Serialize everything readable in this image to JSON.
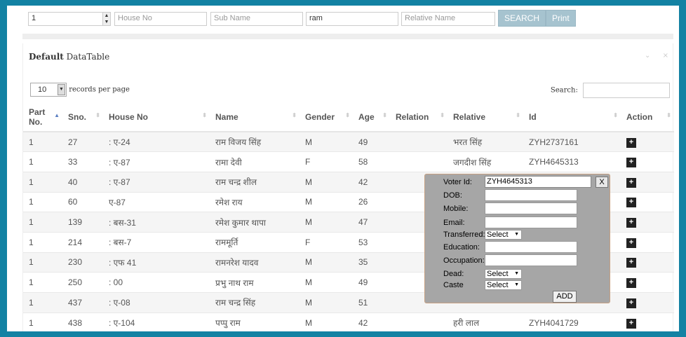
{
  "filters": {
    "part_value": "1",
    "house_placeholder": "House No",
    "subname_placeholder": "Sub Name",
    "name_value": "ram",
    "relative_placeholder": "Relative Name",
    "search_label": "SEARCH",
    "print_label": "Print"
  },
  "panel": {
    "title_bold": "Default",
    "title_rest": " DataTable",
    "collapse_icon": "⌄",
    "close_icon": "×"
  },
  "length": {
    "value": "10",
    "suffix": "records per page"
  },
  "search": {
    "label": "Search:"
  },
  "table": {
    "headers": [
      "Part No.",
      "Sno.",
      "House No",
      "Name",
      "Gender",
      "Age",
      "Relation",
      "Relative",
      "Id",
      "Action"
    ],
    "rows": [
      [
        "1",
        "27",
        ": ए-24",
        "राम विजय सिंह",
        "M",
        "49",
        "",
        "भरत सिंह",
        "ZYH2737161"
      ],
      [
        "1",
        "33",
        ": ए-87",
        "रामा देवी",
        "F",
        "58",
        "",
        "जगदीश सिंह",
        "ZYH4645313"
      ],
      [
        "1",
        "40",
        ": ए-87",
        "राम चन्द्र शील",
        "M",
        "42",
        "",
        "",
        ""
      ],
      [
        "1",
        "60",
        "ए-87",
        "रमेश राय",
        "M",
        "26",
        "",
        "",
        ""
      ],
      [
        "1",
        "139",
        ": बस-31",
        "रमेश कुमार थापा",
        "M",
        "47",
        "",
        "",
        ""
      ],
      [
        "1",
        "214",
        ": बस-7",
        "राममूर्ति",
        "F",
        "53",
        "",
        "",
        ""
      ],
      [
        "1",
        "230",
        ": एफ 41",
        "रामनरेश यादव",
        "M",
        "35",
        "",
        "",
        ""
      ],
      [
        "1",
        "250",
        ": 00",
        "प्रभु नाथ राम",
        "M",
        "49",
        "",
        "",
        ""
      ],
      [
        "1",
        "437",
        ": ए-08",
        "राम चन्द्र सिंह",
        "M",
        "51",
        "",
        "",
        ""
      ],
      [
        "1",
        "438",
        ": ए-104",
        "पप्पु राम",
        "M",
        "42",
        "",
        "हरी लाल",
        "ZYH4041729"
      ]
    ],
    "action_label": "+"
  },
  "popup": {
    "voter_id_label": "Voter Id:",
    "voter_id_value": "ZYH4645313",
    "close_label": "X",
    "dob_label": "DOB:",
    "mobile_label": "Mobile:",
    "email_label": "Email:",
    "transferred_label": "Transferred:",
    "transferred_value": "Select",
    "education_label": "Education:",
    "occupation_label": "Occupation:",
    "dead_label": "Dead:",
    "dead_value": "Select",
    "caste_label": "Caste",
    "caste_value": "Select",
    "add_label": "ADD"
  }
}
